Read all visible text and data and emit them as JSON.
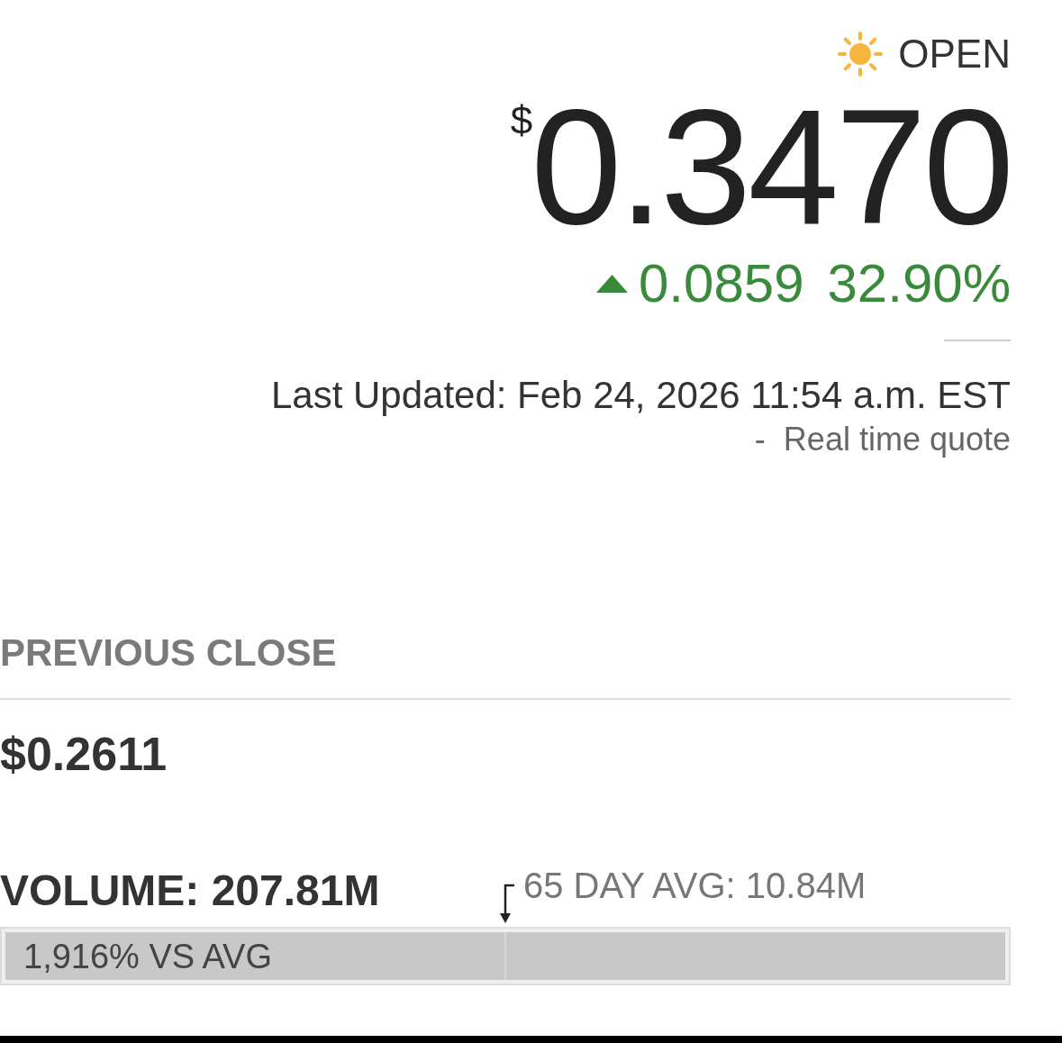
{
  "market_status": {
    "label": "OPEN"
  },
  "price": {
    "currency": "$",
    "value": "0.3470"
  },
  "change": {
    "rising": true,
    "amount": "0.0859",
    "percent": "32.90%"
  },
  "last_updated": "Last Updated: Feb 24, 2026 11:54 a.m. EST",
  "quote_source": {
    "separator": "-",
    "label": "Real time quote"
  },
  "previous_close": {
    "label": "PREVIOUS CLOSE",
    "value": "$0.2611"
  },
  "volume": {
    "label": "VOLUME: 207.81M",
    "average_label": "65 DAY AVG: 10.84M",
    "comparison": "1,916% VS AVG",
    "level": 1,
    "average_marker": {
      "level": 0.5
    }
  }
}
